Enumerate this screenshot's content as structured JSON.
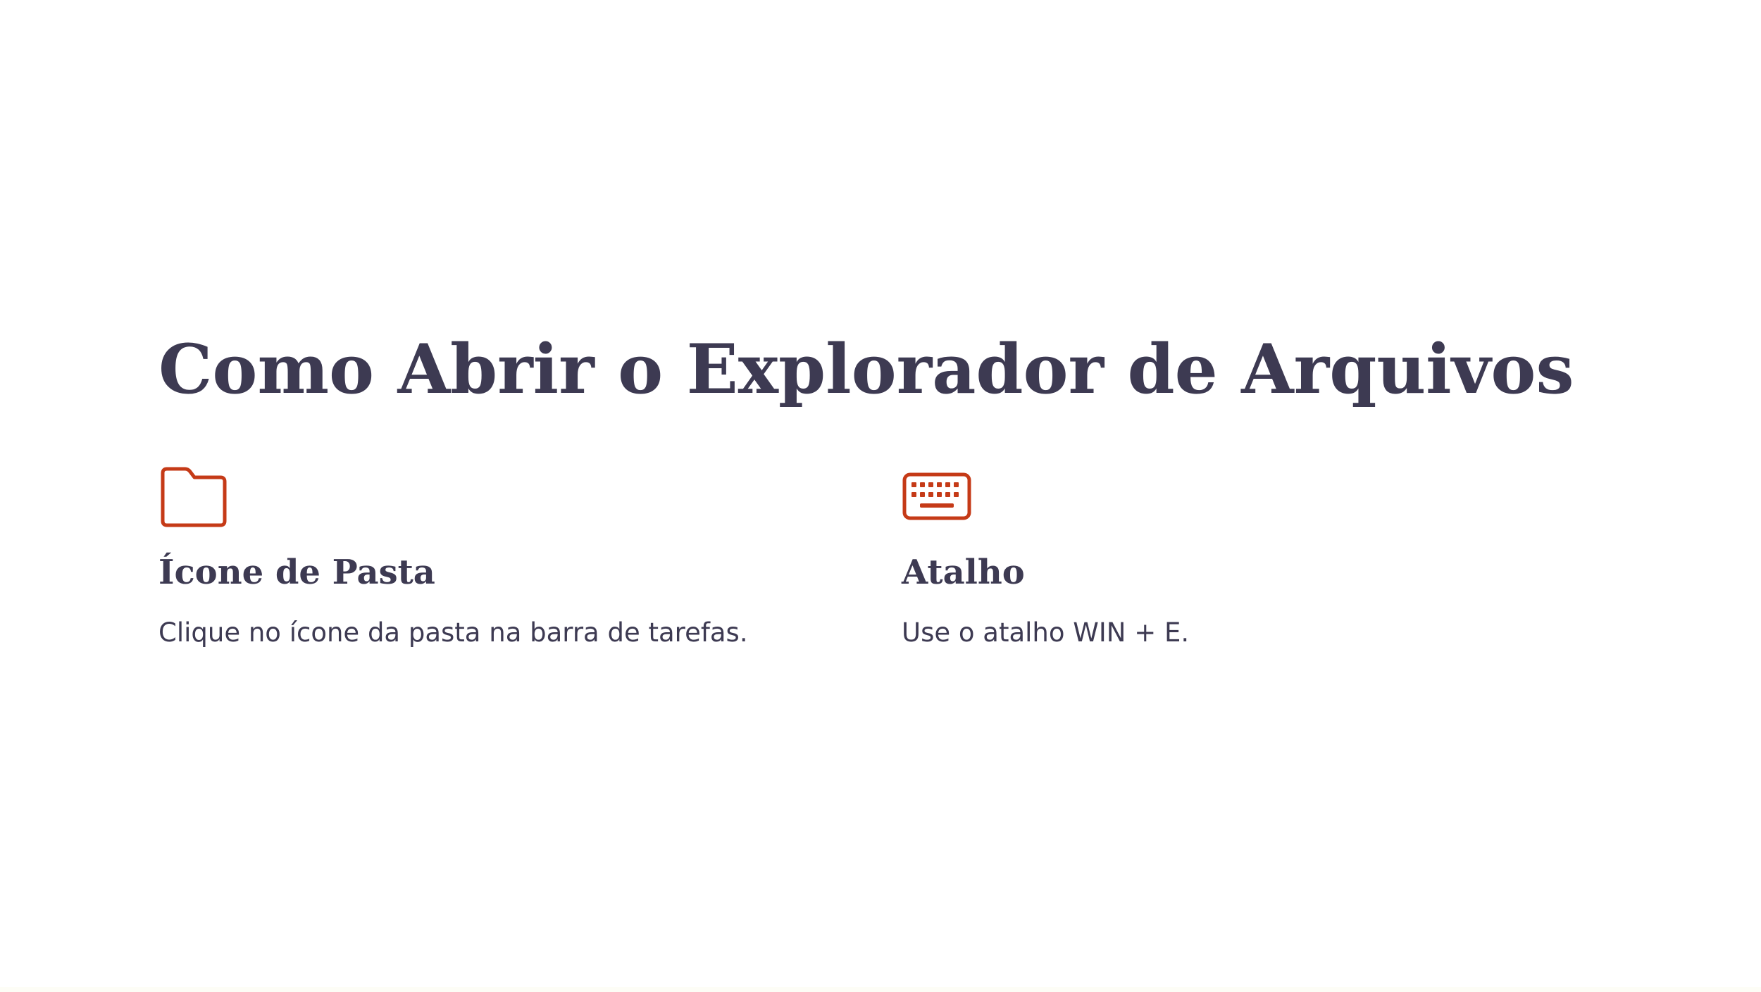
{
  "slide": {
    "title": "Como Abrir o Explorador de Arquivos",
    "accent_color": "#c53a17",
    "text_color": "#3d3a52"
  },
  "cards": [
    {
      "icon": "folder-icon",
      "heading": "Ícone de Pasta",
      "text": "Clique no ícone da pasta na barra de tarefas."
    },
    {
      "icon": "keyboard-icon",
      "heading": "Atalho",
      "text": "Use o atalho WIN + E."
    }
  ]
}
